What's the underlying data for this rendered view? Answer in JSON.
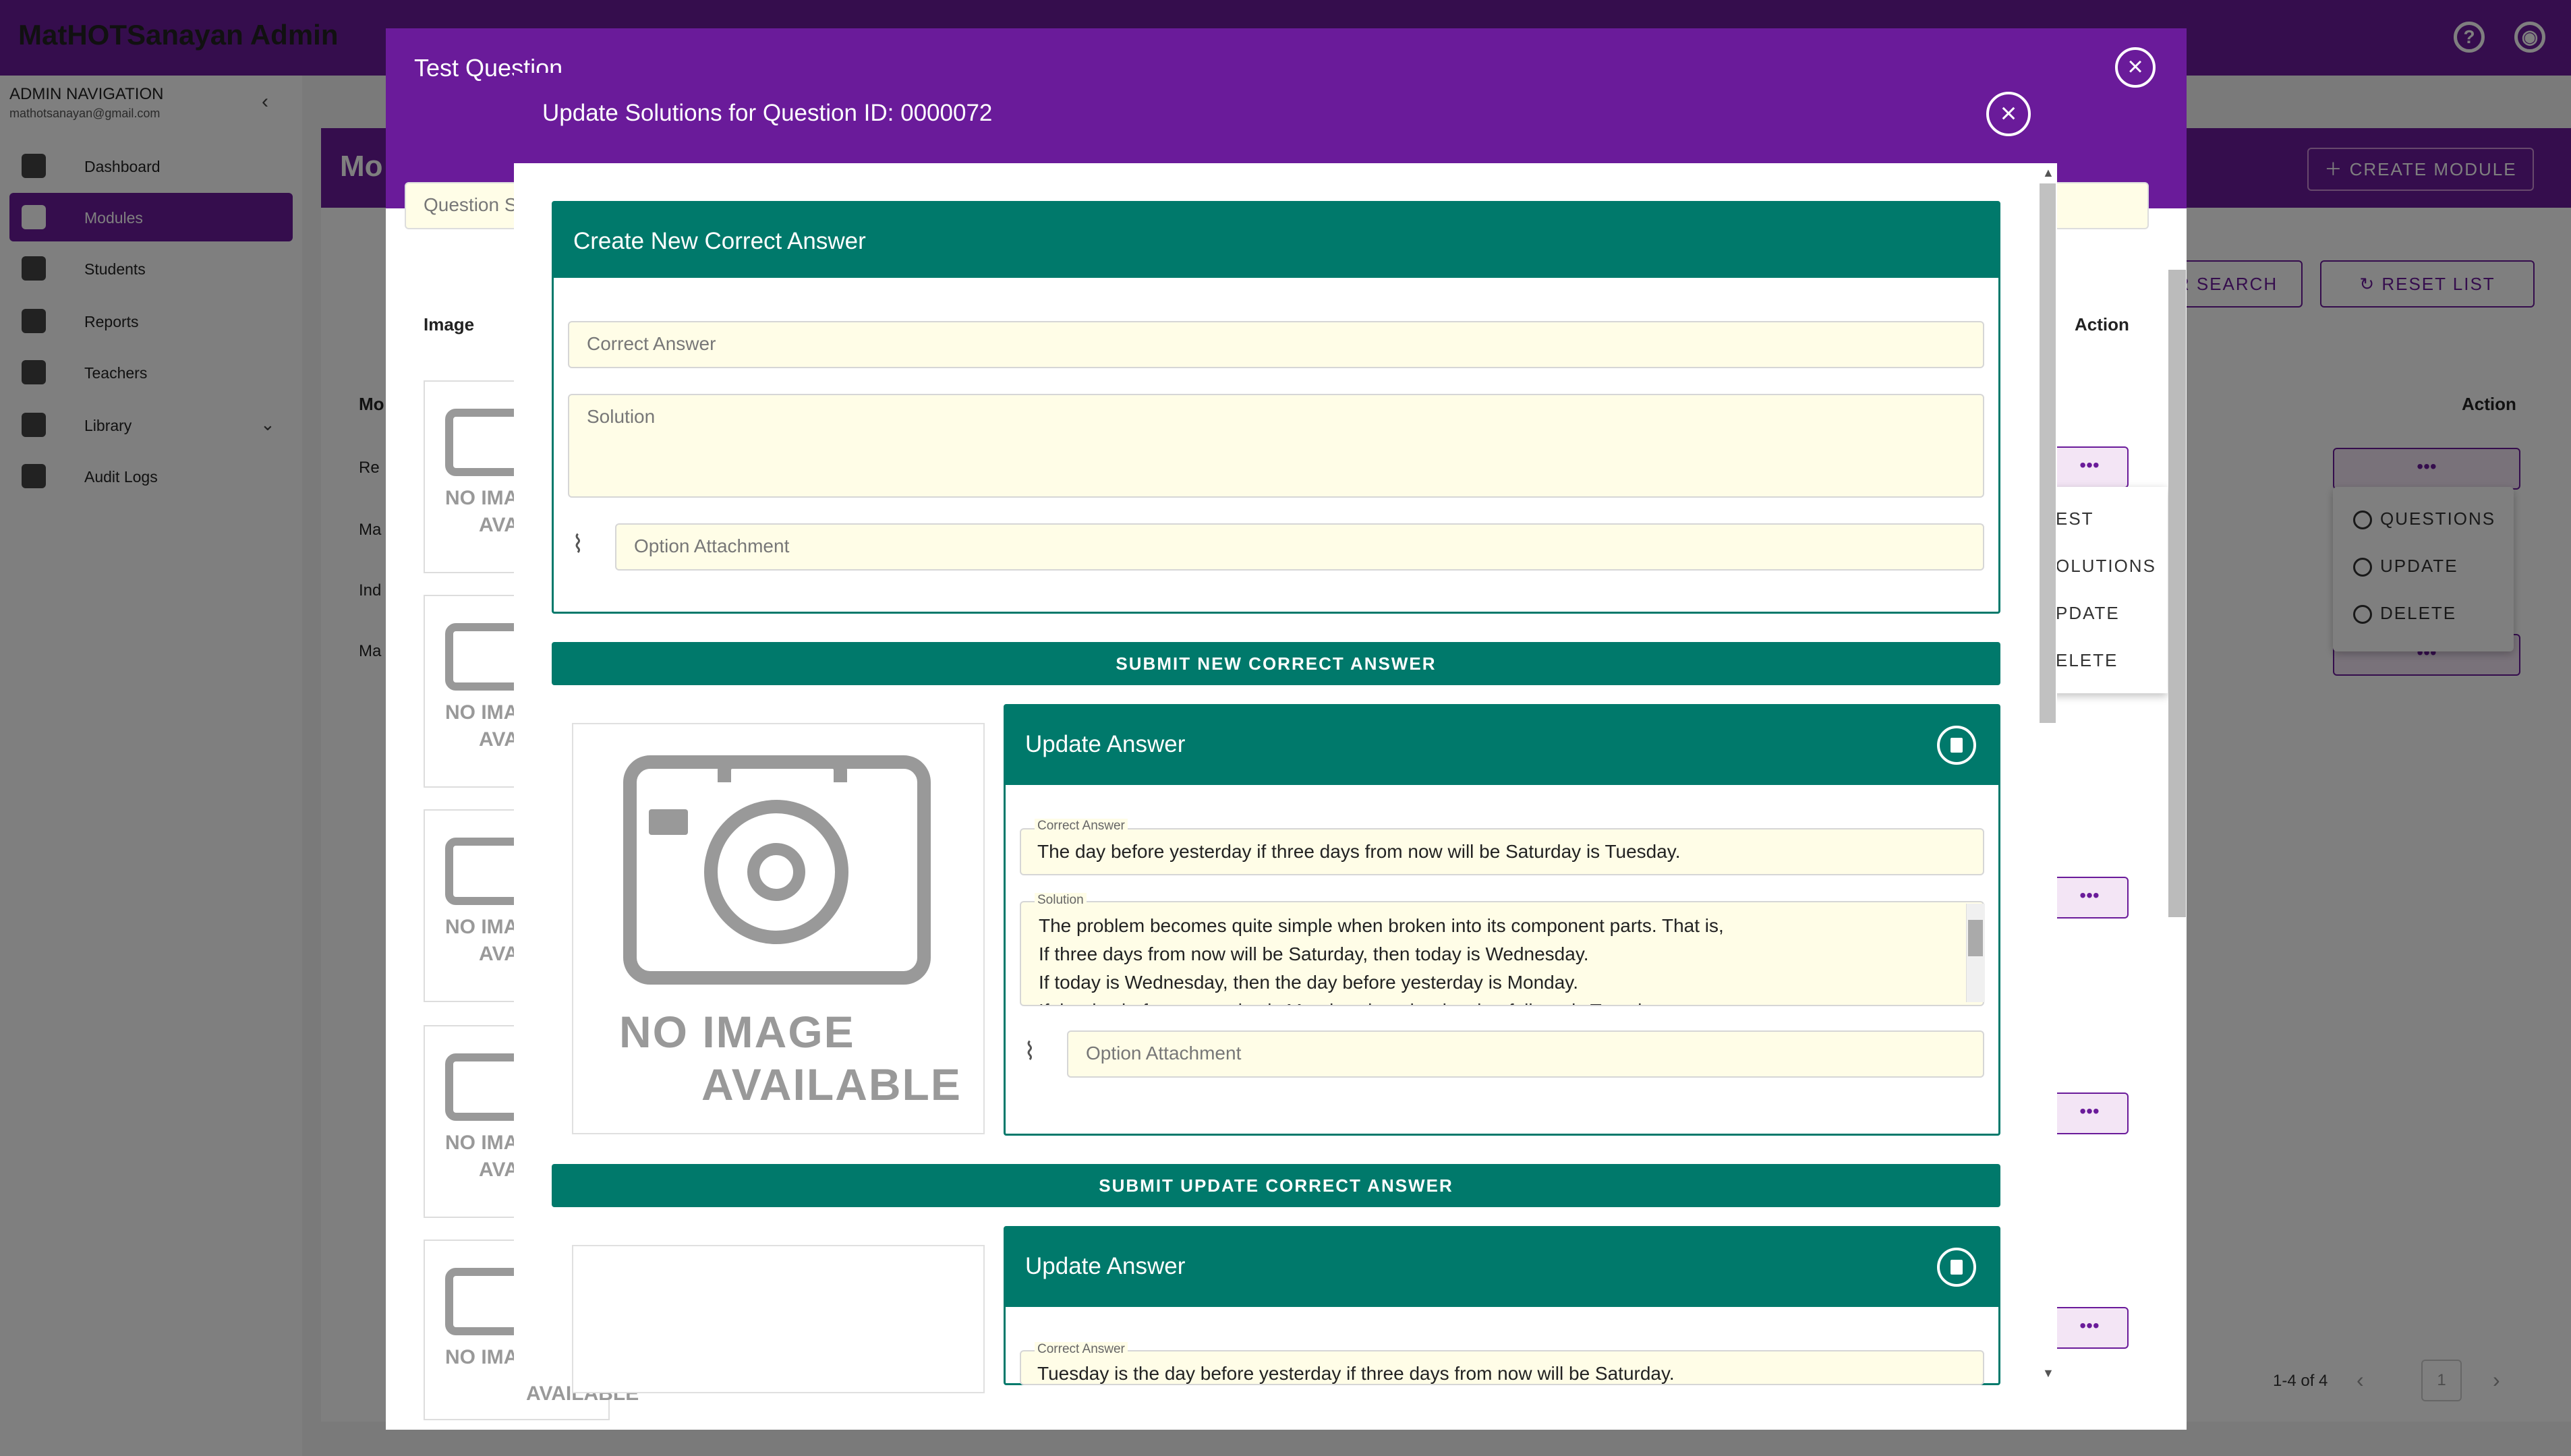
{
  "app": {
    "title": "MatHOTSanayan Admin"
  },
  "topbar": {
    "help_icon": "help-icon",
    "account_icon": "account-circle-icon"
  },
  "sidebar": {
    "title": "ADMIN NAVIGATION",
    "email": "mathotsanayan@gmail.com",
    "collapse_icon": "chevron-left-icon",
    "items": [
      {
        "label": "Dashboard",
        "icon": "home-icon"
      },
      {
        "label": "Modules",
        "icon": "modules-icon",
        "active": true
      },
      {
        "label": "Students",
        "icon": "person-icon"
      },
      {
        "label": "Reports",
        "icon": "checkbox-icon"
      },
      {
        "label": "Teachers",
        "icon": "teacher-icon"
      },
      {
        "label": "Library",
        "icon": "library-icon",
        "has_children": true
      },
      {
        "label": "Audit Logs",
        "icon": "clipboard-icon"
      }
    ]
  },
  "background_page": {
    "title": "Mo",
    "create_button": "CREATE MODULE",
    "search_button": "R SEARCH",
    "reset_button": "RESET LIST",
    "table_action_header": "Action",
    "module_header": "Mo",
    "row_prefixes": [
      "Re",
      "Ma",
      "Ind",
      "Ma"
    ],
    "row_menu": {
      "trigger": "•••",
      "items": [
        "QUESTIONS",
        "UPDATE",
        "DELETE"
      ]
    },
    "pagination": {
      "range": "1-4 of 4",
      "page": "1"
    }
  },
  "test_question_modal": {
    "title": "Test Question",
    "search_placeholder": "Question S",
    "image_header": "Image",
    "action_header": "Action",
    "no_image_line1": "NO IMA",
    "no_image_line2": "AVA",
    "no_image_full_line1": "NO IMAGE",
    "no_image_full_line2": "AVAILABLE",
    "row_menu": {
      "trigger": "•••",
      "items": [
        "EST",
        "OLUTIONS",
        "PDATE",
        "ELETE"
      ]
    }
  },
  "solutions_modal": {
    "title": "Update Solutions for Question ID: 0000072",
    "create_card": {
      "title": "Create New Correct Answer",
      "correct_answer_placeholder": "Correct Answer",
      "solution_placeholder": "Solution",
      "attachment_placeholder": "Option Attachment"
    },
    "submit_new": "SUBMIT NEW CORRECT ANSWER",
    "no_image": {
      "line1": "NO IMAGE",
      "line2": "AVAILABLE"
    },
    "answers": [
      {
        "title": "Update Answer",
        "correct_answer_label": "Correct Answer",
        "correct_answer": "The day before yesterday if three days from now will be Saturday is Tuesday.",
        "solution_label": "Solution",
        "solution_lines": [
          "The problem becomes quite simple when broken into its component parts. That is,",
          "If three days from now will be Saturday, then today is Wednesday.",
          "If today is Wednesday, then the day before yesterday is Monday.",
          "If the day before yesterday is Monday, then the day that follows is Tuesday."
        ],
        "attachment_placeholder": "Option Attachment"
      },
      {
        "title": "Update Answer",
        "correct_answer_label": "Correct Answer",
        "correct_answer": "Tuesday is the day before yesterday if three days from now will be Saturday."
      }
    ],
    "submit_update": "SUBMIT UPDATE CORRECT ANSWER"
  }
}
